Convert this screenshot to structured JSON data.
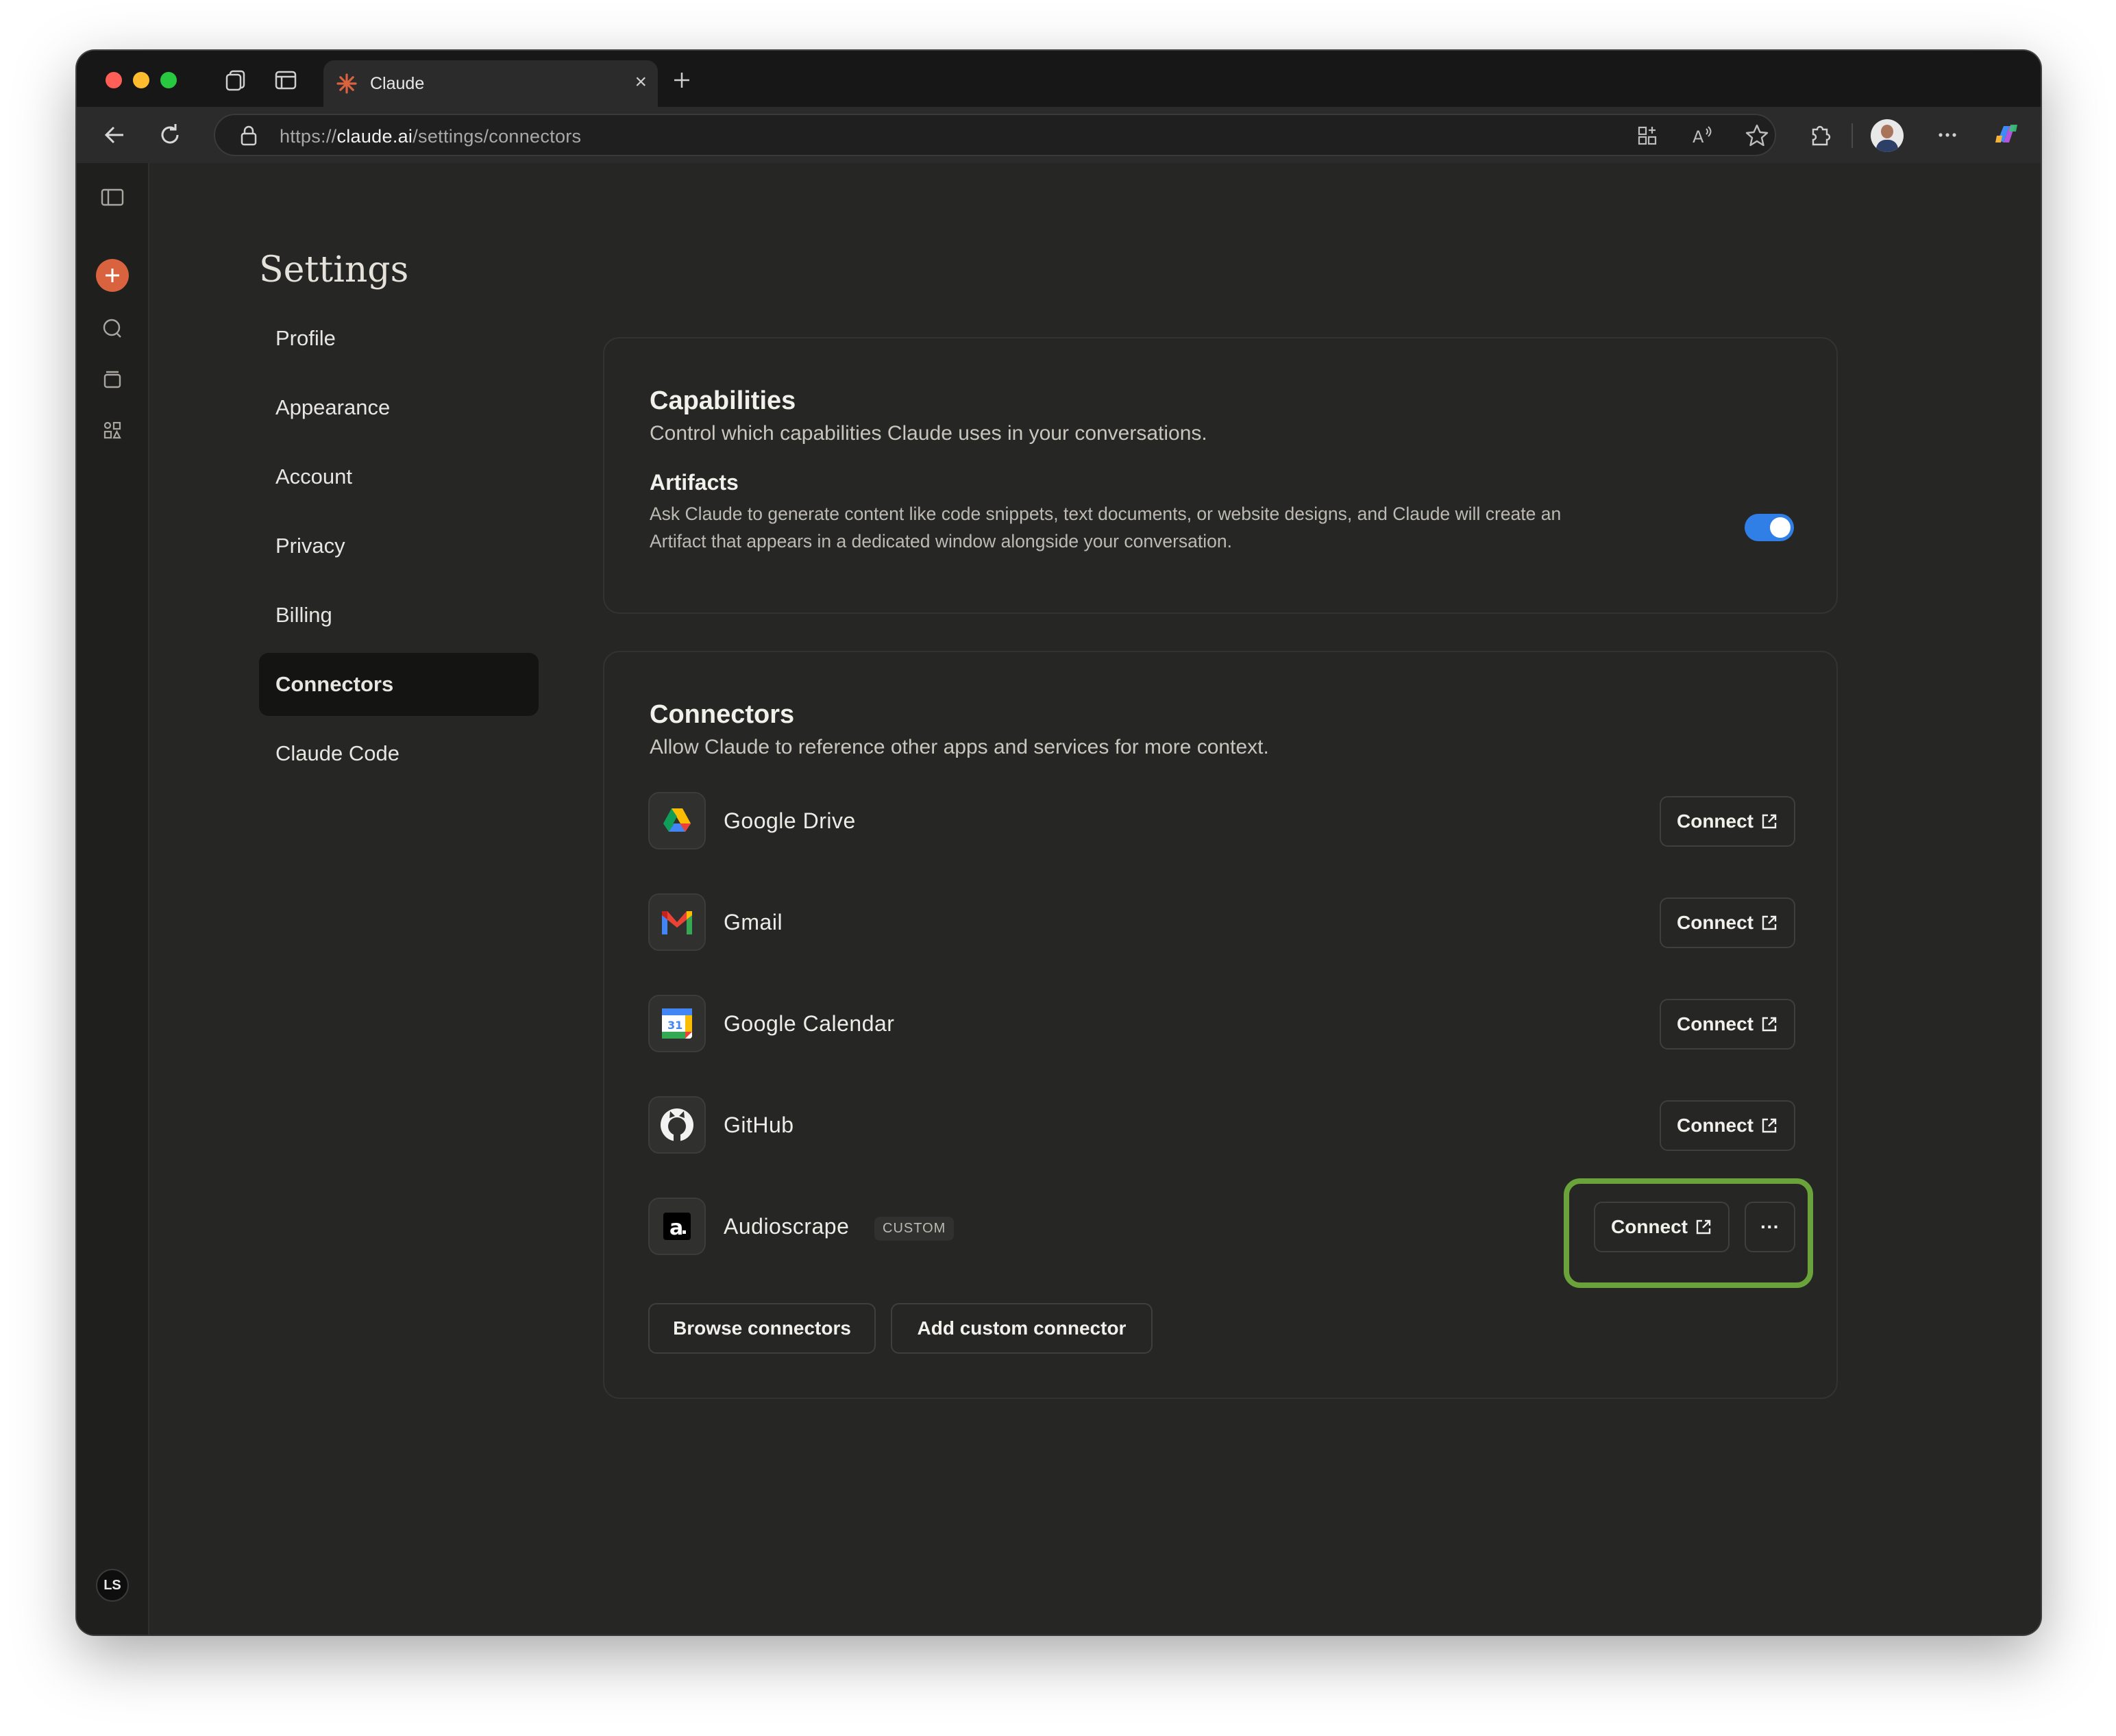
{
  "browser": {
    "tab_title": "Claude",
    "url_prefix": "https://",
    "url_host": "claude.ai",
    "url_path": "/settings/connectors"
  },
  "settings": {
    "title": "Settings",
    "nav": [
      "Profile",
      "Appearance",
      "Account",
      "Privacy",
      "Billing",
      "Connectors",
      "Claude Code"
    ],
    "active_nav": "Connectors"
  },
  "capabilities": {
    "title": "Capabilities",
    "subtitle": "Control which capabilities Claude uses in your conversations.",
    "artifacts_title": "Artifacts",
    "artifacts_desc_line1": "Ask Claude to generate content like code snippets, text documents, or website designs, and Claude will create an",
    "artifacts_desc_line2": "Artifact that appears in a dedicated window alongside your conversation.",
    "artifacts_enabled": true
  },
  "connectors": {
    "title": "Connectors",
    "subtitle": "Allow Claude to reference other apps and services for more context.",
    "items": [
      {
        "name": "Google Drive",
        "icon": "google-drive-icon",
        "action": "Connect"
      },
      {
        "name": "Gmail",
        "icon": "gmail-icon",
        "action": "Connect"
      },
      {
        "name": "Google Calendar",
        "icon": "google-calendar-icon",
        "action": "Connect"
      },
      {
        "name": "GitHub",
        "icon": "github-icon",
        "action": "Connect"
      },
      {
        "name": "Audioscrape",
        "icon": "audioscrape-icon",
        "action": "Connect",
        "badge": "CUSTOM",
        "more": "···"
      }
    ],
    "browse_label": "Browse connectors",
    "add_custom_label": "Add custom connector"
  },
  "user": {
    "initials": "LS"
  },
  "colors": {
    "accent_blue": "#2f7fe6",
    "highlight_green": "#6aa33a",
    "claude_orange": "#d9633f"
  }
}
